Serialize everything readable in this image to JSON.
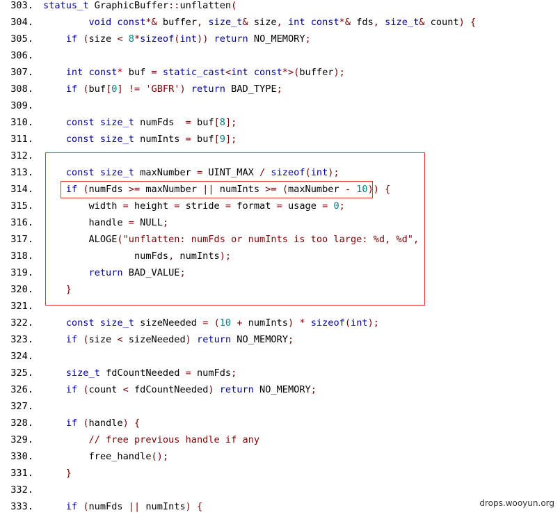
{
  "colors": {
    "keyword": "#0000a0",
    "type": "#0000a0",
    "number": "#008080",
    "string": "#800000",
    "operator": "#800000",
    "comment": "#800000",
    "highlight_box": "#e03030"
  },
  "watermark": "drops.wooyun.org",
  "lines": [
    {
      "n": "303.",
      "tokens": [
        [
          "ty",
          "status_t"
        ],
        [
          "pl",
          " GraphicBuffer"
        ],
        [
          "op",
          "::"
        ],
        [
          "pl",
          "unflatten"
        ],
        [
          "op",
          "("
        ]
      ]
    },
    {
      "n": "304.",
      "tokens": [
        [
          "pl",
          "        "
        ],
        [
          "ty",
          "void"
        ],
        [
          "pl",
          " "
        ],
        [
          "ty",
          "const"
        ],
        [
          "op",
          "*&"
        ],
        [
          "pl",
          " buffer"
        ],
        [
          "op",
          ","
        ],
        [
          "pl",
          " "
        ],
        [
          "ty",
          "size_t"
        ],
        [
          "op",
          "&"
        ],
        [
          "pl",
          " size"
        ],
        [
          "op",
          ","
        ],
        [
          "pl",
          " "
        ],
        [
          "ty",
          "int"
        ],
        [
          "pl",
          " "
        ],
        [
          "ty",
          "const"
        ],
        [
          "op",
          "*&"
        ],
        [
          "pl",
          " fds"
        ],
        [
          "op",
          ","
        ],
        [
          "pl",
          " "
        ],
        [
          "ty",
          "size_t"
        ],
        [
          "op",
          "&"
        ],
        [
          "pl",
          " count"
        ],
        [
          "op",
          ")"
        ],
        [
          "pl",
          " "
        ],
        [
          "op",
          "{"
        ]
      ]
    },
    {
      "n": "305.",
      "tokens": [
        [
          "pl",
          "    "
        ],
        [
          "kw",
          "if"
        ],
        [
          "pl",
          " "
        ],
        [
          "op",
          "("
        ],
        [
          "pl",
          "size "
        ],
        [
          "op",
          "<"
        ],
        [
          "pl",
          " "
        ],
        [
          "num",
          "8"
        ],
        [
          "op",
          "*"
        ],
        [
          "kw",
          "sizeof"
        ],
        [
          "op",
          "("
        ],
        [
          "ty",
          "int"
        ],
        [
          "op",
          "))"
        ],
        [
          "pl",
          " "
        ],
        [
          "kw",
          "return"
        ],
        [
          "pl",
          " NO_MEMORY"
        ],
        [
          "op",
          ";"
        ]
      ]
    },
    {
      "n": "306.",
      "tokens": []
    },
    {
      "n": "307.",
      "tokens": [
        [
          "pl",
          "    "
        ],
        [
          "ty",
          "int"
        ],
        [
          "pl",
          " "
        ],
        [
          "ty",
          "const"
        ],
        [
          "op",
          "*"
        ],
        [
          "pl",
          " buf "
        ],
        [
          "op",
          "="
        ],
        [
          "pl",
          " "
        ],
        [
          "kw",
          "static_cast"
        ],
        [
          "op",
          "<"
        ],
        [
          "ty",
          "int"
        ],
        [
          "pl",
          " "
        ],
        [
          "ty",
          "const"
        ],
        [
          "op",
          "*>("
        ],
        [
          "pl",
          "buffer"
        ],
        [
          "op",
          ");"
        ]
      ]
    },
    {
      "n": "308.",
      "tokens": [
        [
          "pl",
          "    "
        ],
        [
          "kw",
          "if"
        ],
        [
          "pl",
          " "
        ],
        [
          "op",
          "("
        ],
        [
          "pl",
          "buf"
        ],
        [
          "op",
          "["
        ],
        [
          "num",
          "0"
        ],
        [
          "op",
          "]"
        ],
        [
          "pl",
          " "
        ],
        [
          "op",
          "!="
        ],
        [
          "pl",
          " "
        ],
        [
          "str",
          "'GBFR'"
        ],
        [
          "op",
          ")"
        ],
        [
          "pl",
          " "
        ],
        [
          "kw",
          "return"
        ],
        [
          "pl",
          " BAD_TYPE"
        ],
        [
          "op",
          ";"
        ]
      ]
    },
    {
      "n": "309.",
      "tokens": []
    },
    {
      "n": "310.",
      "tokens": [
        [
          "pl",
          "    "
        ],
        [
          "ty",
          "const"
        ],
        [
          "pl",
          " "
        ],
        [
          "ty",
          "size_t"
        ],
        [
          "pl",
          " numFds  "
        ],
        [
          "op",
          "="
        ],
        [
          "pl",
          " buf"
        ],
        [
          "op",
          "["
        ],
        [
          "num",
          "8"
        ],
        [
          "op",
          "];"
        ]
      ]
    },
    {
      "n": "311.",
      "tokens": [
        [
          "pl",
          "    "
        ],
        [
          "ty",
          "const"
        ],
        [
          "pl",
          " "
        ],
        [
          "ty",
          "size_t"
        ],
        [
          "pl",
          " numInts "
        ],
        [
          "op",
          "="
        ],
        [
          "pl",
          " buf"
        ],
        [
          "op",
          "["
        ],
        [
          "num",
          "9"
        ],
        [
          "op",
          "];"
        ]
      ]
    },
    {
      "n": "312.",
      "tokens": []
    },
    {
      "n": "313.",
      "tokens": [
        [
          "pl",
          "    "
        ],
        [
          "ty",
          "const"
        ],
        [
          "pl",
          " "
        ],
        [
          "ty",
          "size_t"
        ],
        [
          "pl",
          " maxNumber "
        ],
        [
          "op",
          "="
        ],
        [
          "pl",
          " UINT_MAX "
        ],
        [
          "op",
          "/"
        ],
        [
          "pl",
          " "
        ],
        [
          "kw",
          "sizeof"
        ],
        [
          "op",
          "("
        ],
        [
          "ty",
          "int"
        ],
        [
          "op",
          ");"
        ]
      ]
    },
    {
      "n": "314.",
      "tokens": [
        [
          "pl",
          "    "
        ],
        [
          "kw",
          "if"
        ],
        [
          "pl",
          " "
        ],
        [
          "op",
          "("
        ],
        [
          "pl",
          "numFds "
        ],
        [
          "op",
          ">="
        ],
        [
          "pl",
          " maxNumber "
        ],
        [
          "op",
          "||"
        ],
        [
          "pl",
          " numInts "
        ],
        [
          "op",
          ">="
        ],
        [
          "pl",
          " "
        ],
        [
          "op",
          "("
        ],
        [
          "pl",
          "maxNumber "
        ],
        [
          "op",
          "-"
        ],
        [
          "pl",
          " "
        ],
        [
          "num",
          "10"
        ],
        [
          "op",
          "))"
        ],
        [
          "pl",
          " "
        ],
        [
          "op",
          "{"
        ]
      ]
    },
    {
      "n": "315.",
      "tokens": [
        [
          "pl",
          "        width "
        ],
        [
          "op",
          "="
        ],
        [
          "pl",
          " height "
        ],
        [
          "op",
          "="
        ],
        [
          "pl",
          " stride "
        ],
        [
          "op",
          "="
        ],
        [
          "pl",
          " format "
        ],
        [
          "op",
          "="
        ],
        [
          "pl",
          " usage "
        ],
        [
          "op",
          "="
        ],
        [
          "pl",
          " "
        ],
        [
          "num",
          "0"
        ],
        [
          "op",
          ";"
        ]
      ]
    },
    {
      "n": "316.",
      "tokens": [
        [
          "pl",
          "        handle "
        ],
        [
          "op",
          "="
        ],
        [
          "pl",
          " NULL"
        ],
        [
          "op",
          ";"
        ]
      ]
    },
    {
      "n": "317.",
      "tokens": [
        [
          "pl",
          "        ALOGE"
        ],
        [
          "op",
          "("
        ],
        [
          "str",
          "\"unflatten: numFds or numInts is too large: %d, %d\""
        ],
        [
          "op",
          ","
        ]
      ]
    },
    {
      "n": "318.",
      "tokens": [
        [
          "pl",
          "                numFds"
        ],
        [
          "op",
          ","
        ],
        [
          "pl",
          " numInts"
        ],
        [
          "op",
          ");"
        ]
      ]
    },
    {
      "n": "319.",
      "tokens": [
        [
          "pl",
          "        "
        ],
        [
          "kw",
          "return"
        ],
        [
          "pl",
          " BAD_VALUE"
        ],
        [
          "op",
          ";"
        ]
      ]
    },
    {
      "n": "320.",
      "tokens": [
        [
          "pl",
          "    "
        ],
        [
          "op",
          "}"
        ]
      ]
    },
    {
      "n": "321.",
      "tokens": []
    },
    {
      "n": "322.",
      "tokens": [
        [
          "pl",
          "    "
        ],
        [
          "ty",
          "const"
        ],
        [
          "pl",
          " "
        ],
        [
          "ty",
          "size_t"
        ],
        [
          "pl",
          " sizeNeeded "
        ],
        [
          "op",
          "="
        ],
        [
          "pl",
          " "
        ],
        [
          "op",
          "("
        ],
        [
          "num",
          "10"
        ],
        [
          "pl",
          " "
        ],
        [
          "op",
          "+"
        ],
        [
          "pl",
          " numInts"
        ],
        [
          "op",
          ")"
        ],
        [
          "pl",
          " "
        ],
        [
          "op",
          "*"
        ],
        [
          "pl",
          " "
        ],
        [
          "kw",
          "sizeof"
        ],
        [
          "op",
          "("
        ],
        [
          "ty",
          "int"
        ],
        [
          "op",
          ");"
        ]
      ]
    },
    {
      "n": "323.",
      "tokens": [
        [
          "pl",
          "    "
        ],
        [
          "kw",
          "if"
        ],
        [
          "pl",
          " "
        ],
        [
          "op",
          "("
        ],
        [
          "pl",
          "size "
        ],
        [
          "op",
          "<"
        ],
        [
          "pl",
          " sizeNeeded"
        ],
        [
          "op",
          ")"
        ],
        [
          "pl",
          " "
        ],
        [
          "kw",
          "return"
        ],
        [
          "pl",
          " NO_MEMORY"
        ],
        [
          "op",
          ";"
        ]
      ]
    },
    {
      "n": "324.",
      "tokens": []
    },
    {
      "n": "325.",
      "tokens": [
        [
          "pl",
          "    "
        ],
        [
          "ty",
          "size_t"
        ],
        [
          "pl",
          " fdCountNeeded "
        ],
        [
          "op",
          "="
        ],
        [
          "pl",
          " numFds"
        ],
        [
          "op",
          ";"
        ]
      ]
    },
    {
      "n": "326.",
      "tokens": [
        [
          "pl",
          "    "
        ],
        [
          "kw",
          "if"
        ],
        [
          "pl",
          " "
        ],
        [
          "op",
          "("
        ],
        [
          "pl",
          "count "
        ],
        [
          "op",
          "<"
        ],
        [
          "pl",
          " fdCountNeeded"
        ],
        [
          "op",
          ")"
        ],
        [
          "pl",
          " "
        ],
        [
          "kw",
          "return"
        ],
        [
          "pl",
          " NO_MEMORY"
        ],
        [
          "op",
          ";"
        ]
      ]
    },
    {
      "n": "327.",
      "tokens": []
    },
    {
      "n": "328.",
      "tokens": [
        [
          "pl",
          "    "
        ],
        [
          "kw",
          "if"
        ],
        [
          "pl",
          " "
        ],
        [
          "op",
          "("
        ],
        [
          "pl",
          "handle"
        ],
        [
          "op",
          ")"
        ],
        [
          "pl",
          " "
        ],
        [
          "op",
          "{"
        ]
      ]
    },
    {
      "n": "329.",
      "tokens": [
        [
          "pl",
          "        "
        ],
        [
          "cmt",
          "// free previous handle if any"
        ]
      ]
    },
    {
      "n": "330.",
      "tokens": [
        [
          "pl",
          "        free_handle"
        ],
        [
          "op",
          "();"
        ]
      ]
    },
    {
      "n": "331.",
      "tokens": [
        [
          "pl",
          "    "
        ],
        [
          "op",
          "}"
        ]
      ]
    },
    {
      "n": "332.",
      "tokens": []
    },
    {
      "n": "333.",
      "tokens": [
        [
          "pl",
          "    "
        ],
        [
          "kw",
          "if"
        ],
        [
          "pl",
          " "
        ],
        [
          "op",
          "("
        ],
        [
          "pl",
          "numFds "
        ],
        [
          "op",
          "||"
        ],
        [
          "pl",
          " numInts"
        ],
        [
          "op",
          ")"
        ],
        [
          "pl",
          " "
        ],
        [
          "op",
          "{"
        ]
      ]
    }
  ]
}
